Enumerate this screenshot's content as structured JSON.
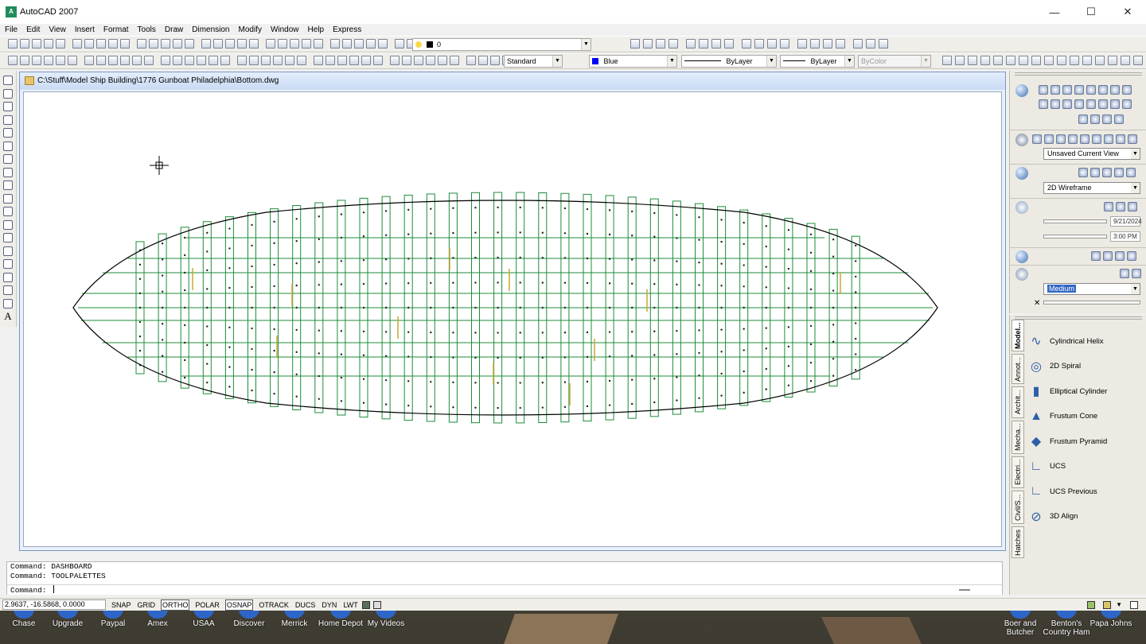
{
  "window": {
    "title": "AutoCAD 2007",
    "minimize": "—",
    "maximize": "☐",
    "close": "✕"
  },
  "menu": [
    "File",
    "Edit",
    "View",
    "Insert",
    "Format",
    "Tools",
    "Draw",
    "Dimension",
    "Modify",
    "Window",
    "Help",
    "Express"
  ],
  "toolbar": {
    "layer_value": "0",
    "text_style": "Standard",
    "color": "Blue",
    "color_hex": "#0000ff",
    "linetype": "ByLayer",
    "lineweight": "ByLayer",
    "plotstyle": "ByColor"
  },
  "drawing": {
    "path": "C:\\Stuff\\Model Ship Building\\1776 Gunboat Philadelphia\\Bottom.dwg",
    "outline_color": "#000000",
    "frame_color": "#1e8c3a",
    "accent_color": "#c7a832"
  },
  "command": {
    "history": [
      "Command: DASHBOARD",
      "Command: TOOLPALETTES"
    ],
    "prompt": "Command:"
  },
  "status": {
    "coords": "2.9637, -16.5868, 0.0000",
    "buttons": [
      {
        "label": "SNAP",
        "on": false
      },
      {
        "label": "GRID",
        "on": false
      },
      {
        "label": "ORTHO",
        "on": true
      },
      {
        "label": "POLAR",
        "on": false
      },
      {
        "label": "OSNAP",
        "on": true
      },
      {
        "label": "OTRACK",
        "on": false
      },
      {
        "label": "DUCS",
        "on": false
      },
      {
        "label": "DYN",
        "on": false
      },
      {
        "label": "LWT",
        "on": false
      }
    ]
  },
  "dashboard": {
    "view": "Unsaved Current View",
    "visual_style": "2D Wireframe",
    "date": "9/21/2024",
    "time": "3:00 PM",
    "quality": "Medium"
  },
  "palette": {
    "tabs": [
      "Model...",
      "Annot...",
      "Archit...",
      "Mecha...",
      "Electri...",
      "Civil/S...",
      "Hatches"
    ],
    "items": [
      {
        "label": "Cylindrical Helix",
        "icon": "helix-icon",
        "glyph": "∿"
      },
      {
        "label": "2D Spiral",
        "icon": "spiral-icon",
        "glyph": "◎"
      },
      {
        "label": "Elliptical Cylinder",
        "icon": "cylinder-icon",
        "glyph": "▮"
      },
      {
        "label": "Frustum Cone",
        "icon": "cone-icon",
        "glyph": "▲"
      },
      {
        "label": "Frustum Pyramid",
        "icon": "pyramid-icon",
        "glyph": "◆"
      },
      {
        "label": "UCS",
        "icon": "ucs-icon",
        "glyph": "∟"
      },
      {
        "label": "UCS Previous",
        "icon": "ucs-previous-icon",
        "glyph": "∟"
      },
      {
        "label": "3D Align",
        "icon": "align-icon",
        "glyph": "⊘"
      }
    ]
  },
  "taskbar": [
    {
      "label": "Chase"
    },
    {
      "label": "Upgrade"
    },
    {
      "label": "Paypal"
    },
    {
      "label": "Amex"
    },
    {
      "label": "USAA"
    },
    {
      "label": "Discover"
    },
    {
      "label": "Merrick"
    },
    {
      "label": "Home Depot"
    },
    {
      "label": "My Videos"
    },
    {
      "label": "Boer and Butcher"
    },
    {
      "label": "Benton's Country Ham"
    },
    {
      "label": "Papa Johns"
    }
  ]
}
